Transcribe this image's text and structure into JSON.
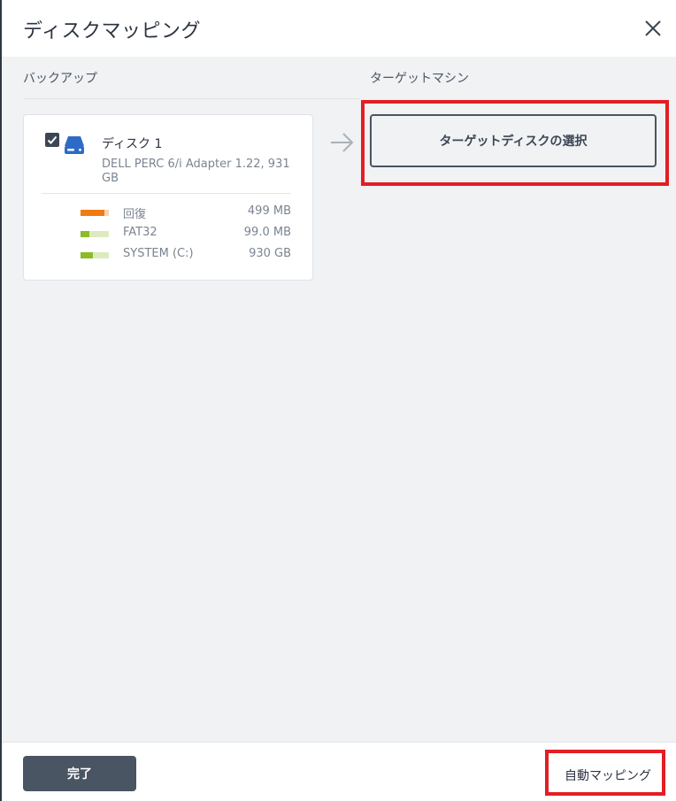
{
  "dialog": {
    "title": "ディスクマッピング"
  },
  "columns": {
    "backup_label": "バックアップ",
    "target_label": "ターゲットマシン"
  },
  "disk": {
    "checked": true,
    "name": "ディスク 1",
    "description": "DELL PERC 6/i Adapter 1.22, 931 GB",
    "partitions": [
      {
        "name": "回復",
        "size": "499 MB",
        "color": "#f07b12",
        "track": "#f7d4b5",
        "fill_fraction": 0.85
      },
      {
        "name": "FAT32",
        "size": "99.0 MB",
        "color": "#8cbb2a",
        "track": "#dcebbf",
        "fill_fraction": 0.3
      },
      {
        "name": "SYSTEM (C:)",
        "size": "930 GB",
        "color": "#8cbb2a",
        "track": "#dcebbf",
        "fill_fraction": 0.45
      }
    ]
  },
  "target": {
    "button_label": "ターゲットディスクの選択"
  },
  "footer": {
    "done_label": "完了",
    "auto_mapping_label": "自動マッピング"
  },
  "colors": {
    "highlight": "#e31e24",
    "primary_button": "#4a5563",
    "disk_icon": "#2e6bc6"
  },
  "icons": {
    "close": "close-icon",
    "checkbox": "checkmark-icon",
    "disk": "hard-disk-icon",
    "arrow": "arrow-right-icon"
  }
}
